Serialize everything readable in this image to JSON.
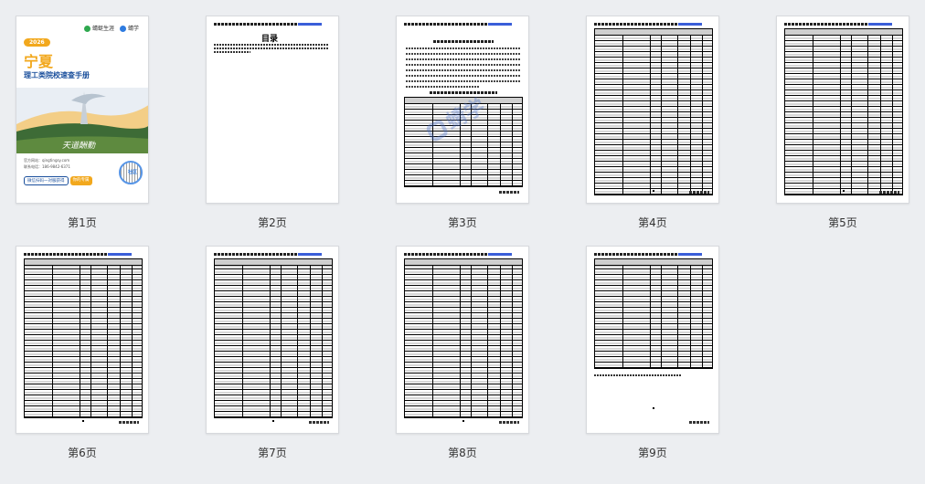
{
  "pages": [
    {
      "label": "第1页"
    },
    {
      "label": "第2页"
    },
    {
      "label": "第3页"
    },
    {
      "label": "第4页"
    },
    {
      "label": "第5页"
    },
    {
      "label": "第6页"
    },
    {
      "label": "第7页"
    },
    {
      "label": "第8页"
    },
    {
      "label": "第9页"
    }
  ],
  "cover": {
    "brand1": "蜻蜓生涯",
    "brand2": "蜻学",
    "year": "2026",
    "region": "宁夏",
    "subtitle": "理工类院校速查手册",
    "calligraphy": "天道酬勤",
    "info_website": "官方网站：qingtingsy.com",
    "info_phone": "联系电话：186-9842-6371",
    "banner_scan": "微信扫码一对服获得",
    "banner_cta": "你的专属",
    "qr_label": "社区"
  },
  "toc_title": "目录",
  "section_title": "宁夏理工类院校汇总一览表",
  "watermark": "蜻学",
  "colors": {
    "accent_orange": "#f2a81d",
    "brand_blue": "#1a4f9c",
    "link_blue": "#3a5ed9"
  }
}
